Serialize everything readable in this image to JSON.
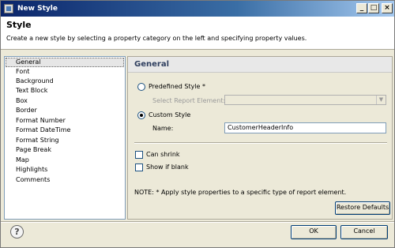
{
  "window": {
    "title": "New Style",
    "controls": {
      "minimize": "_",
      "maximize": "□",
      "close": "×"
    }
  },
  "header": {
    "title": "Style",
    "description": "Create a new style by selecting a property category on the left and specifying property values."
  },
  "nav": {
    "items": [
      {
        "label": "General",
        "selected": true
      },
      {
        "label": "Font"
      },
      {
        "label": "Background"
      },
      {
        "label": "Text Block"
      },
      {
        "label": "Box"
      },
      {
        "label": "Border"
      },
      {
        "label": "Format Number"
      },
      {
        "label": "Format DateTime"
      },
      {
        "label": "Format String"
      },
      {
        "label": "Page Break"
      },
      {
        "label": "Map"
      },
      {
        "label": "Highlights"
      },
      {
        "label": "Comments"
      }
    ]
  },
  "panel": {
    "title": "General",
    "predefined_style": {
      "label": "Predefined Style *",
      "checked": false
    },
    "select_report_element": {
      "label": "Select Report Element:",
      "value": "",
      "arrow": "▼"
    },
    "custom_style": {
      "label": "Custom Style",
      "checked": true
    },
    "name": {
      "label": "Name:",
      "value": "CustomerHeaderInfo"
    },
    "can_shrink": {
      "label": "Can shrink",
      "checked": false
    },
    "show_if_blank": {
      "label": "Show if blank",
      "checked": false
    },
    "note": "NOTE: * Apply style properties to a specific type of report element.",
    "restore_defaults_label": "Restore Defaults"
  },
  "footer": {
    "help_glyph": "?",
    "ok_label": "OK",
    "cancel_label": "Cancel"
  },
  "icons": {
    "window_icon": "style-window-icon",
    "help": "help-icon",
    "dropdown": "chevron-down-icon"
  },
  "colors": {
    "titlebar_start": "#0a246a",
    "titlebar_end": "#a6caf0",
    "dialog_background": "#ece9d8",
    "section_title": "#2f3f5f"
  }
}
